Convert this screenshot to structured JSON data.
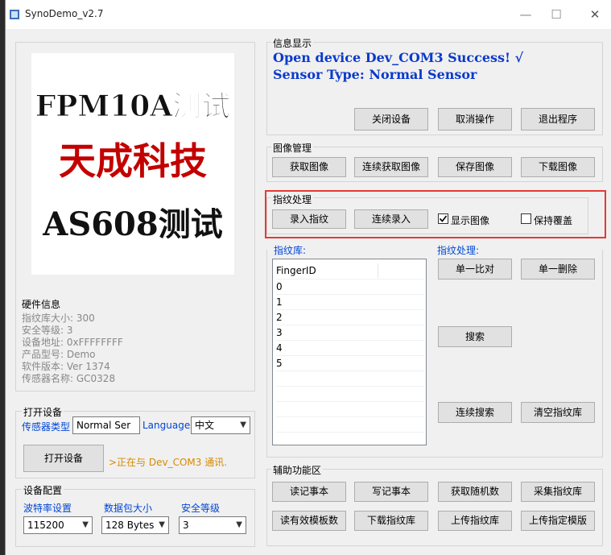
{
  "window": {
    "title": "SynoDemo_v2.7",
    "min_icon": "minimize-icon",
    "max_icon": "maximize-icon",
    "close_icon": "close-icon"
  },
  "logo": {
    "line1": "FPM10A测试",
    "line2": "天成科技",
    "line3": "AS608测试"
  },
  "hardware": {
    "title": "硬件信息",
    "lines": [
      "指纹库大小: 300",
      "安全等级: 3",
      "设备地址: 0xFFFFFFFF",
      "产品型号:  Demo",
      "软件版本: Ver 1374",
      "传感器名称: GC0328"
    ]
  },
  "open_device": {
    "title": "打开设备",
    "sensor_type_label": "传感器类型",
    "sensor_type_value": "Normal Ser",
    "language_label": "Language",
    "language_value": "中文",
    "open_button": "打开设备",
    "status": ">正在与 Dev_COM3 通讯."
  },
  "device_config": {
    "title": "设备配置",
    "baud_label": "波特率设置",
    "baud_value": "115200",
    "packet_label": "数据包大小",
    "packet_value": "128 Bytes",
    "security_label": "安全等级",
    "security_value": "3"
  },
  "info_display": {
    "title": "信息显示",
    "line1": "Open device Dev_COM3 Success! √",
    "line2": "Sensor Type: Normal Sensor",
    "buttons": [
      "关闭设备",
      "取消操作",
      "退出程序"
    ]
  },
  "image_mgmt": {
    "title": "图像管理",
    "buttons": [
      "获取图像",
      "连续获取图像",
      "保存图像",
      "下载图像"
    ]
  },
  "fp_process": {
    "title": "指纹处理",
    "enroll": "录入指纹",
    "continuous_enroll": "连续录入",
    "show_image_label": "显示图像",
    "show_image_checked": true,
    "keep_cover_label": "保持覆盖",
    "keep_cover_checked": false
  },
  "fp_library": {
    "title": "指纹库:",
    "column": "FingerID",
    "rows": [
      "0",
      "1",
      "2",
      "3",
      "4",
      "5"
    ]
  },
  "fp_ops": {
    "title": "指纹处理:",
    "single_compare": "单一比对",
    "single_delete": "单一删除",
    "search": "搜索",
    "continuous_search": "连续搜索",
    "clear_library": "清空指纹库"
  },
  "aux": {
    "title": "辅助功能区",
    "row1": [
      "读记事本",
      "写记事本",
      "获取随机数",
      "采集指纹库"
    ],
    "row2": [
      "读有效模板数",
      "下载指纹库",
      "上传指纹库",
      "上传指定模版"
    ]
  }
}
